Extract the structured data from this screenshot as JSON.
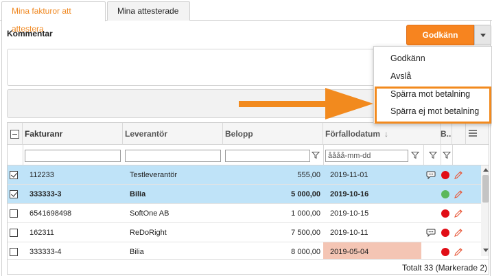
{
  "tabs": [
    {
      "label": "Mina fakturor att attestera",
      "active": true
    },
    {
      "label": "Mina attesterade",
      "active": false
    }
  ],
  "comment": {
    "label": "Kommentar"
  },
  "approve_button": {
    "label": "Godkänn"
  },
  "dropdown": {
    "items": [
      "Godkänn",
      "Avslå",
      "Spärra mot betalning",
      "Spärra ej mot betalning"
    ],
    "highlighted": [
      "Spärra mot betalning",
      "Spärra ej mot betalning"
    ]
  },
  "grid": {
    "columns": [
      "Fakturanr",
      "Leverantör",
      "Belopp",
      "Förfallodatum",
      "B..."
    ],
    "sort_indicator": "↓",
    "date_placeholder": "åååå-mm-dd",
    "rows": [
      {
        "fakturanr": "112233",
        "leverantor": "Testleverantör",
        "belopp": "555,00",
        "forfallodatum": "2019-11-01",
        "checked": true,
        "selected": true,
        "bold": false,
        "comment_icon": true,
        "status": "red",
        "overdue": false
      },
      {
        "fakturanr": "333333-3",
        "leverantor": "Bilia",
        "belopp": "5 000,00",
        "forfallodatum": "2019-10-16",
        "checked": true,
        "selected": true,
        "bold": true,
        "comment_icon": false,
        "status": "green",
        "overdue": false
      },
      {
        "fakturanr": "6541698498",
        "leverantor": "SoftOne AB",
        "belopp": "1 000,00",
        "forfallodatum": "2019-10-15",
        "checked": false,
        "selected": false,
        "bold": false,
        "comment_icon": false,
        "status": "red",
        "overdue": false
      },
      {
        "fakturanr": "162311",
        "leverantor": "ReDoRight",
        "belopp": "7 500,00",
        "forfallodatum": "2019-10-11",
        "checked": false,
        "selected": false,
        "bold": false,
        "comment_icon": true,
        "status": "red",
        "overdue": false
      },
      {
        "fakturanr": "333333-4",
        "leverantor": "Bilia",
        "belopp": "8 000,00",
        "forfallodatum": "2019-05-04",
        "checked": false,
        "selected": false,
        "bold": false,
        "comment_icon": false,
        "status": "red",
        "overdue": true
      }
    ],
    "footer": "Totalt 33  (Markerade 2)"
  },
  "colors": {
    "accent": "#f7841f",
    "selected_row": "#bfe3f8",
    "overdue": "#f4c5b4",
    "status_red": "#e10d16",
    "status_green": "#5cb85c"
  },
  "icons": [
    "checkbox-icon",
    "filter-funnel-icon",
    "column-menu-icon",
    "comment-bubble-icon",
    "status-dot-icon",
    "edit-pencil-icon",
    "caret-down-icon",
    "arrow-right-icon"
  ]
}
